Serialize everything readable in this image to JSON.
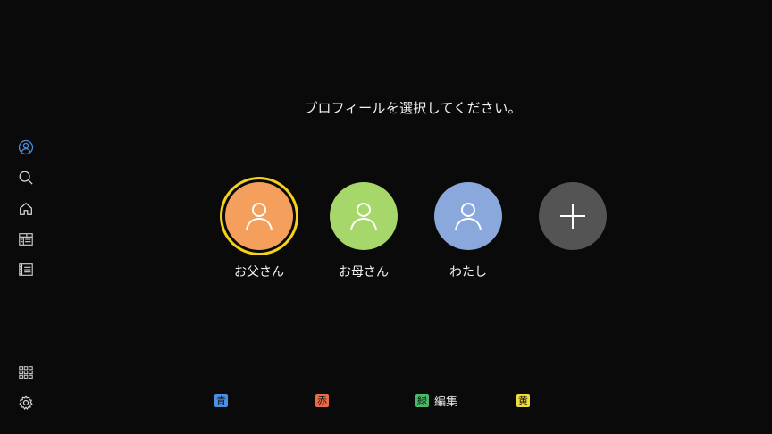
{
  "prompt": "プロフィールを選択してください。",
  "sidebar": {
    "items": [
      {
        "name": "profile",
        "icon": "user-circle-icon",
        "active": true,
        "color": "#4a8fe0"
      },
      {
        "name": "search",
        "icon": "search-icon"
      },
      {
        "name": "home",
        "icon": "home-icon"
      },
      {
        "name": "program-guide",
        "icon": "tv-guide-icon"
      },
      {
        "name": "recordings",
        "icon": "film-list-icon"
      },
      {
        "name": "apps",
        "icon": "apps-grid-icon"
      },
      {
        "name": "settings",
        "icon": "gear-icon"
      }
    ]
  },
  "profiles": [
    {
      "name": "お父さん",
      "color": "#f4a05c",
      "selected": true,
      "icon": "user-icon"
    },
    {
      "name": "お母さん",
      "color": "#a6d76b",
      "selected": false,
      "icon": "user-icon"
    },
    {
      "name": "わたし",
      "color": "#8ba8dc",
      "selected": false,
      "icon": "user-icon"
    }
  ],
  "add_profile": {
    "icon": "plus-icon",
    "color": "#545454"
  },
  "selection_color": "#f7d21c",
  "color_keys": [
    {
      "chip": "青",
      "label": "",
      "color": "#4a90e2"
    },
    {
      "chip": "赤",
      "label": "",
      "color": "#ea6b4a"
    },
    {
      "chip": "緑",
      "label": "編集",
      "color": "#4cb86a"
    },
    {
      "chip": "黄",
      "label": "",
      "color": "#f1dc3c"
    }
  ]
}
